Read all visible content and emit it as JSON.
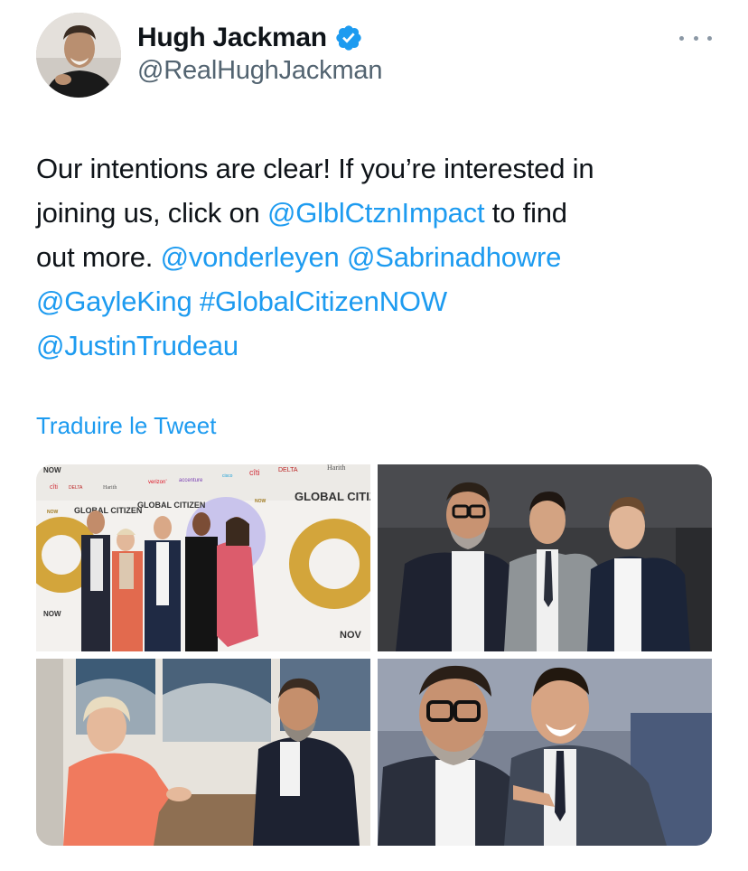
{
  "author": {
    "display_name": "Hugh Jackman",
    "handle": "@RealHughJackman",
    "verified_icon": "verified-badge-icon",
    "avatar_icon": "profile-photo"
  },
  "menu": {
    "more_icon": "more-options-icon"
  },
  "tweet": {
    "segments": [
      {
        "text": "Our intentions are clear! If you’re interested in",
        "type": "text"
      },
      {
        "text": "joining us, click on ",
        "type": "text"
      },
      {
        "text": "@GlblCtznImpact",
        "type": "mention"
      },
      {
        "text": " to find",
        "type": "text"
      },
      {
        "text": "out more. ",
        "type": "text"
      },
      {
        "text": "@vonderleyen",
        "type": "mention"
      },
      {
        "text": " ",
        "type": "text"
      },
      {
        "text": "@Sabrinadhowre",
        "type": "mention"
      },
      {
        "text": "@GayleKing",
        "type": "mention"
      },
      {
        "text": " ",
        "type": "text"
      },
      {
        "text": "#GlobalCitizenNOW",
        "type": "hashtag"
      },
      {
        "text": "@JustinTrudeau",
        "type": "mention"
      }
    ],
    "line1": "Our intentions are clear! If you’re interested in",
    "line2_pre": "joining us, click on ",
    "line2_link": "@GlblCtznImpact",
    "line2_post": " to find",
    "line3_pre": "out more. ",
    "line3_link1": "@vonderleyen",
    "line3_link2": "@Sabrinadhowre",
    "line4_link1": "@GayleKing",
    "line4_link2": "#GlobalCitizenNOW",
    "line5_link": "@JustinTrudeau",
    "translate_label": "Traduire le Tweet"
  },
  "media": {
    "photos": [
      {
        "description": "group-photo-at-global-citizen-now-backdrop",
        "signs": [
          "cîti",
          "DELTA",
          "Harith",
          "verizon’",
          "accenture",
          "cisco",
          "NOW",
          "GLOBAL CITIZEN",
          "NOW",
          "GLOBAL CITIZEN",
          "NOW",
          "NOV"
        ]
      },
      {
        "description": "three-men-posing-in-suits"
      },
      {
        "description": "woman-in-coral-jacket-and-man-pointing"
      },
      {
        "description": "two-men-selfie-pointing"
      }
    ]
  },
  "colors": {
    "link": "#1d9bf0",
    "handle": "#536471",
    "text": "#0f1419",
    "verified": "#1d9bf0"
  }
}
